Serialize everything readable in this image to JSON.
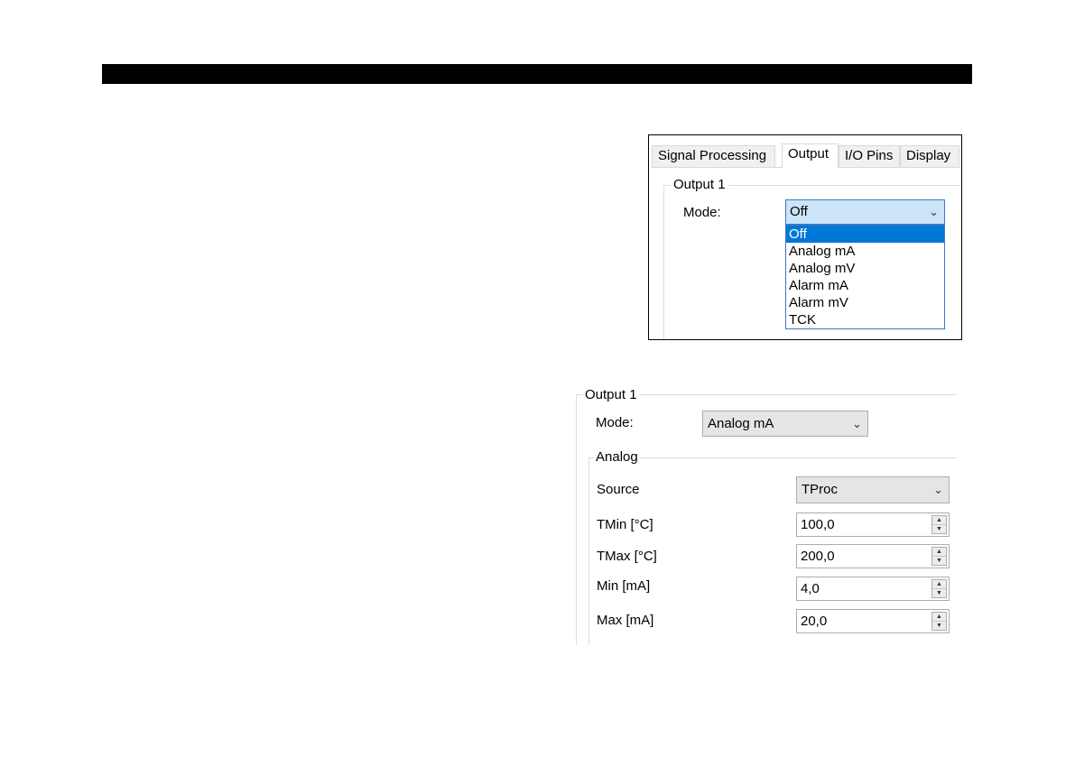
{
  "shot1": {
    "tabs": [
      "Signal Processing",
      "Output",
      "I/O Pins",
      "Display"
    ],
    "active_tab": "Output",
    "group_title": "Output 1",
    "mode_label": "Mode:",
    "mode_value": "Off",
    "options": [
      "Off",
      "Analog mA",
      "Analog mV",
      "Alarm mA",
      "Alarm mV",
      "TCK"
    ],
    "selected_option": "Off"
  },
  "shot2": {
    "group_title": "Output 1",
    "mode_label": "Mode:",
    "mode_value": "Analog mA",
    "analog_title": "Analog",
    "source_label": "Source",
    "source_value": "TProc",
    "fields": [
      {
        "label": "TMin [°C]",
        "value": "100,0"
      },
      {
        "label": "TMax [°C]",
        "value": "200,0"
      },
      {
        "label": "Min [mA]",
        "value": "4,0"
      },
      {
        "label": "Max [mA]",
        "value": "20,0"
      }
    ]
  },
  "icons": {
    "chevron": "chevron-down-icon",
    "spinner": "spinner-arrows-icon"
  }
}
